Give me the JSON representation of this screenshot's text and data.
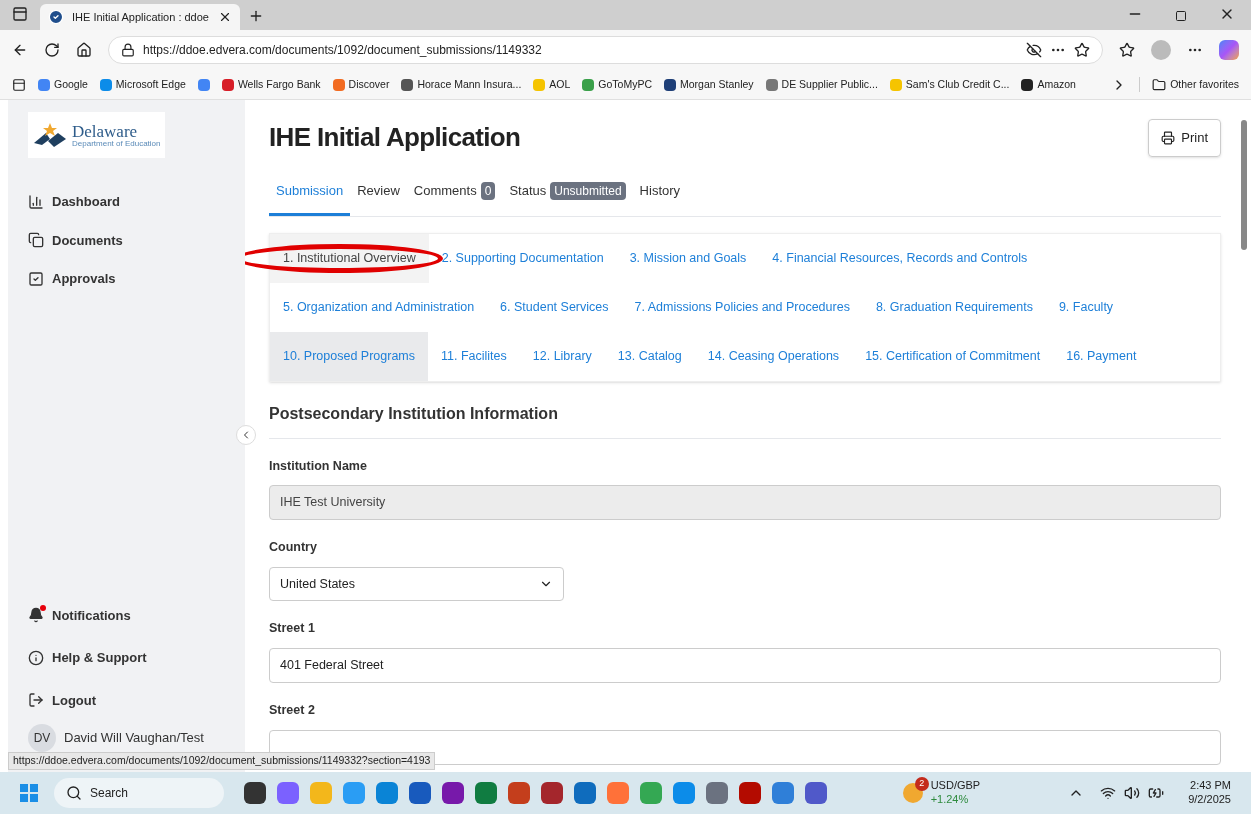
{
  "browser": {
    "tab_title": "IHE Initial Application : ddoe",
    "url": "https://ddoe.edvera.com/documents/1092/document_submissions/1149332",
    "bookmarks": [
      {
        "label": "Google",
        "color": "#4285f4"
      },
      {
        "label": "Microsoft Edge",
        "color": "#0c8ce9"
      },
      {
        "color": "#4285f4"
      },
      {
        "label": "Wells Fargo Bank",
        "color": "#d71e28"
      },
      {
        "label": "Discover",
        "color": "#f26b21"
      },
      {
        "label": "Horace Mann Insura...",
        "color": "#555555"
      },
      {
        "label": "AOL",
        "color": "#f5c400"
      },
      {
        "label": "GoToMyPC",
        "color": "#3aa04a"
      },
      {
        "label": "Morgan Stanley",
        "color": "#1f3f77"
      },
      {
        "label": "DE Supplier Public...",
        "color": "#777777"
      },
      {
        "label": "Sam's Club Credit C...",
        "color": "#f5c400"
      },
      {
        "label": "Amazon",
        "color": "#222222"
      }
    ],
    "other_favorites": "Other favorites",
    "status_url": "https://ddoe.edvera.com/documents/1092/document_submissions/1149332?section=4193"
  },
  "sidebar": {
    "logo_title": "Delaware",
    "logo_subtitle": "Department of Education",
    "nav": [
      {
        "label": "Dashboard",
        "kind": "chart"
      },
      {
        "label": "Documents",
        "kind": "copy"
      },
      {
        "label": "Approvals",
        "kind": "check"
      }
    ],
    "bottom": [
      {
        "label": "Notifications",
        "kind": "bell"
      },
      {
        "label": "Help & Support",
        "kind": "info"
      },
      {
        "label": "Logout",
        "kind": "logout"
      }
    ],
    "user": {
      "initials": "DV",
      "name": "David Will Vaughan/Test"
    }
  },
  "page": {
    "title": "IHE Initial Application",
    "print": "Print",
    "tabs": [
      {
        "label": "Submission",
        "selected": true
      },
      {
        "label": "Review",
        "selected": false
      },
      {
        "label": "Comments",
        "badge": "0",
        "selected": false
      },
      {
        "label": "Status",
        "badge": "Unsubmitted",
        "selected": false
      },
      {
        "label": "History",
        "selected": false
      }
    ],
    "sections": [
      [
        {
          "label": "1. Institutional Overview",
          "selected": true,
          "highlighted": false,
          "circled": true
        },
        {
          "label": "2. Supporting Documentation",
          "selected": false,
          "highlighted": false,
          "circled": false
        },
        {
          "label": "3. Mission and Goals",
          "selected": false,
          "highlighted": false,
          "circled": false
        },
        {
          "label": "4. Financial Resources, Records and Controls",
          "selected": false,
          "highlighted": false,
          "circled": false
        }
      ],
      [
        {
          "label": "5. Organization and Administration",
          "selected": false,
          "highlighted": false,
          "circled": false
        },
        {
          "label": "6. Student Services",
          "selected": false,
          "highlighted": false,
          "circled": false
        },
        {
          "label": "7. Admissions Policies and Procedures",
          "selected": false,
          "highlighted": false,
          "circled": false
        },
        {
          "label": "8. Graduation Requirements",
          "selected": false,
          "highlighted": false,
          "circled": false
        },
        {
          "label": "9. Faculty",
          "selected": false,
          "highlighted": false,
          "circled": false
        }
      ],
      [
        {
          "label": "10. Proposed Programs",
          "selected": false,
          "highlighted": true,
          "circled": false
        },
        {
          "label": "11. Facilites",
          "selected": false,
          "highlighted": false,
          "circled": false
        },
        {
          "label": "12. Library",
          "selected": false,
          "highlighted": false,
          "circled": false
        },
        {
          "label": "13. Catalog",
          "selected": false,
          "highlighted": false,
          "circled": false
        },
        {
          "label": "14. Ceasing Operations",
          "selected": false,
          "highlighted": false,
          "circled": false
        },
        {
          "label": "15. Certification of Commitment",
          "selected": false,
          "highlighted": false,
          "circled": false
        },
        {
          "label": "16. Payment",
          "selected": false,
          "highlighted": false,
          "circled": false
        }
      ]
    ],
    "form_title": "Postsecondary Institution Information",
    "fields": [
      {
        "label": "Institution Name",
        "kind": "text",
        "value": "IHE Test University",
        "disabled": true
      },
      {
        "label": "Country",
        "kind": "select",
        "value": "United States"
      },
      {
        "label": "Street 1",
        "kind": "text",
        "value": "401 Federal Street",
        "disabled": false
      },
      {
        "label": "Street 2",
        "kind": "text",
        "disabled": false
      }
    ]
  },
  "taskbar": {
    "search": "Search",
    "widget_badge": "2",
    "widget_title": "USD/GBP",
    "widget_value": "+1.24%",
    "time": "2:43 PM",
    "date": "9/2/2025"
  }
}
